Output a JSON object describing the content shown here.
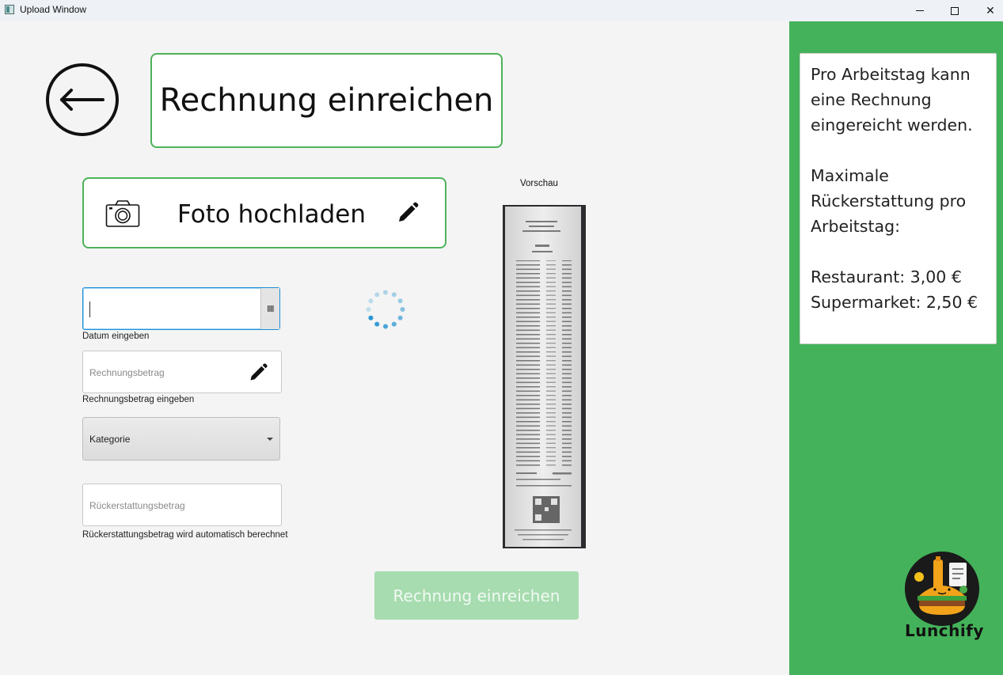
{
  "window": {
    "title": "Upload Window",
    "minimize_label": "",
    "maximize_label": "",
    "close_label": "✕"
  },
  "header": {
    "back_icon": "arrow-left-circle-icon",
    "title": "Rechnung einreichen"
  },
  "upload": {
    "label": "Foto hochladen",
    "left_icon": "camera-icon",
    "right_icon": "pencil-icon"
  },
  "form": {
    "date": {
      "value": "",
      "caption": "Datum eingeben",
      "picker_icon": "calendar-icon"
    },
    "amount": {
      "placeholder": "Rechnungsbetrag",
      "caption": "Rechnungsbetrag eingeben",
      "icon": "pencil-icon"
    },
    "category": {
      "selected": "Kategorie"
    },
    "refund": {
      "placeholder": "Rückerstattungsbetrag",
      "caption": "Rückerstattungsbetrag wird automatisch berechnet"
    }
  },
  "preview": {
    "label": "Vorschau"
  },
  "submit": {
    "label": "Rechnung einreichen",
    "enabled": false
  },
  "side_panel": {
    "info_paragraph_1": "Pro Arbeitstag kann\neine Rechnung\neingereicht werden.",
    "info_paragraph_2": "Maximale\nRückerstattung pro\nArbeitstag:",
    "info_line_restaurant": "Restaurant: 3,00 €",
    "info_line_supermarket": "Supermarket: 2,50 €",
    "logo_text": "Lunchify"
  },
  "colors": {
    "accent_green": "#44b25a",
    "border_green": "#4cb35a",
    "submit_disabled": "#a6dcaf",
    "focus_blue": "#1a8fd6",
    "spinner_blue": "#2a96d2"
  }
}
